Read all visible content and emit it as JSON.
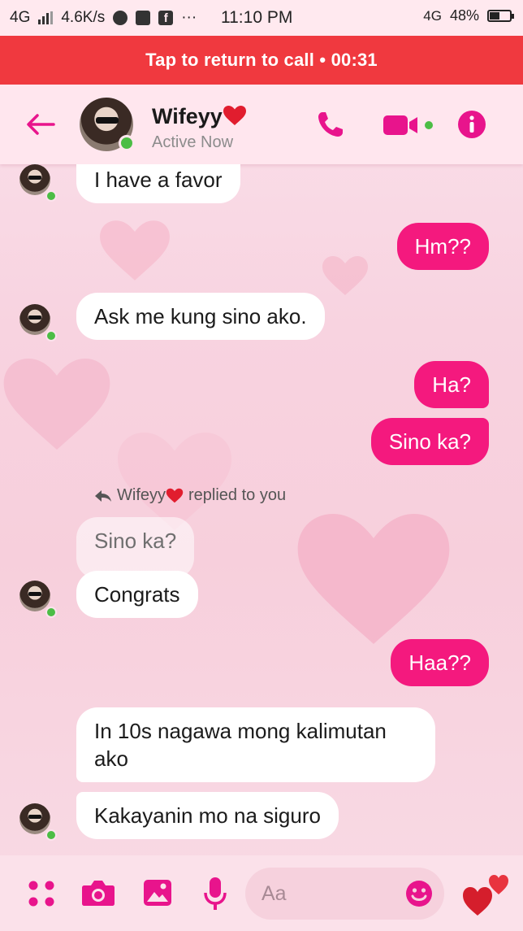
{
  "status_bar": {
    "network": "4G",
    "speed": "4.6K/s",
    "extra": "···",
    "time": "11:10 PM",
    "network_right": "4G",
    "battery": "48%",
    "battery_level": 0.48
  },
  "call_banner": {
    "text": "Tap to return to call • 00:31"
  },
  "header": {
    "contact_name": "Wifeyy",
    "status": "Active Now",
    "icons": [
      "back-arrow-icon",
      "phone-icon",
      "video-camera-icon",
      "info-icon"
    ],
    "accent_color": "#e8148c"
  },
  "messages": [
    {
      "side": "in",
      "text": "I have a favor"
    },
    {
      "side": "out",
      "text": "Hm??"
    },
    {
      "side": "in",
      "text": "Ask me kung sino ako."
    },
    {
      "side": "out",
      "text": "Ha?"
    },
    {
      "side": "out",
      "text": "Sino ka?"
    },
    {
      "side": "in",
      "text": "Sino ka?",
      "quoted": true
    },
    {
      "side": "in",
      "text": "Congrats"
    },
    {
      "side": "out",
      "text": "Haa??"
    },
    {
      "side": "in",
      "text": "In 10s nagawa mong kalimutan ako"
    },
    {
      "side": "in",
      "text": "Kakayanin mo na siguro"
    }
  ],
  "reply_note": {
    "name": "Wifeyy",
    "text": "replied to you"
  },
  "composer": {
    "placeholder": "Aa",
    "icons": [
      "menu-dots-icon",
      "camera-icon",
      "image-icon",
      "microphone-icon",
      "emoji-icon",
      "heart-like-icon"
    ]
  },
  "colors": {
    "outgoing": "#f4197e",
    "incoming": "#ffffff",
    "banner": "#f0393f"
  }
}
